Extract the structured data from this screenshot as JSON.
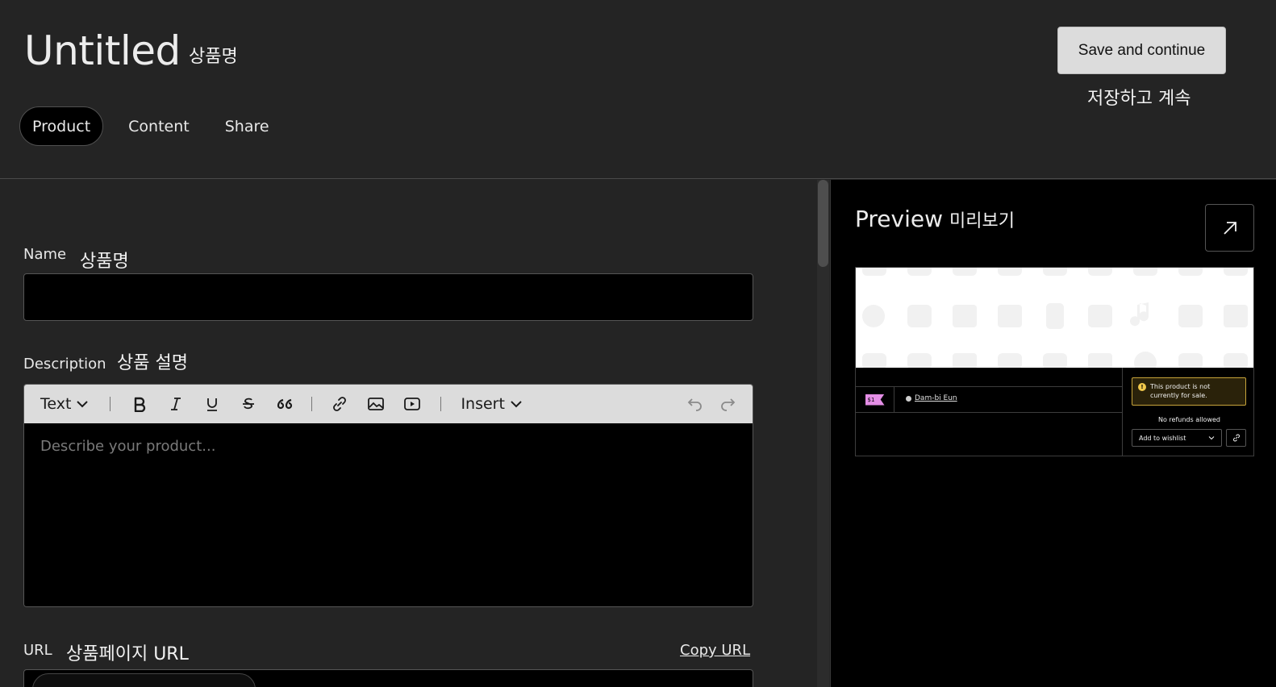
{
  "header": {
    "title": "Untitled",
    "title_ko": "상품명",
    "save_label": "Save and continue",
    "save_ko": "저장하고 계속",
    "tabs": [
      {
        "label": "Product",
        "active": true
      },
      {
        "label": "Content",
        "active": false
      },
      {
        "label": "Share",
        "active": false
      }
    ]
  },
  "form": {
    "name_label": "Name",
    "name_ko": "상품명",
    "name_value": "",
    "description_label": "Description",
    "description_ko": "상품 설명",
    "description_placeholder": "Describe your product...",
    "toolbar": {
      "text_style": "Text",
      "insert": "Insert"
    },
    "url_label": "URL",
    "url_ko": "상품페이지 URL",
    "copy_url": "Copy URL"
  },
  "preview": {
    "title": "Preview",
    "title_ko": "미리보기",
    "card": {
      "price": "$1",
      "seller": "Dam-bi Eun",
      "warning": "This product is not currently for sale.",
      "refund": "No refunds allowed",
      "wishlist": "Add to wishlist"
    }
  },
  "colors": {
    "background": "#242424",
    "input_bg": "#000000",
    "toolbar_bg": "#dcdcdc",
    "price_tag": "#e48ee6",
    "warning_border": "#c7a43a"
  }
}
